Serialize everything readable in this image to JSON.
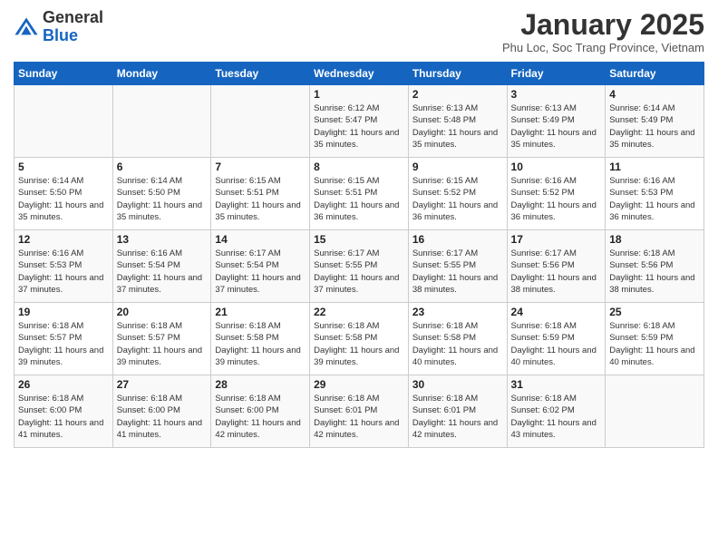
{
  "header": {
    "logo_general": "General",
    "logo_blue": "Blue",
    "month_title": "January 2025",
    "subtitle": "Phu Loc, Soc Trang Province, Vietnam"
  },
  "days_of_week": [
    "Sunday",
    "Monday",
    "Tuesday",
    "Wednesday",
    "Thursday",
    "Friday",
    "Saturday"
  ],
  "weeks": [
    [
      {
        "day": "",
        "info": ""
      },
      {
        "day": "",
        "info": ""
      },
      {
        "day": "",
        "info": ""
      },
      {
        "day": "1",
        "info": "Sunrise: 6:12 AM\nSunset: 5:47 PM\nDaylight: 11 hours and 35 minutes."
      },
      {
        "day": "2",
        "info": "Sunrise: 6:13 AM\nSunset: 5:48 PM\nDaylight: 11 hours and 35 minutes."
      },
      {
        "day": "3",
        "info": "Sunrise: 6:13 AM\nSunset: 5:49 PM\nDaylight: 11 hours and 35 minutes."
      },
      {
        "day": "4",
        "info": "Sunrise: 6:14 AM\nSunset: 5:49 PM\nDaylight: 11 hours and 35 minutes."
      }
    ],
    [
      {
        "day": "5",
        "info": "Sunrise: 6:14 AM\nSunset: 5:50 PM\nDaylight: 11 hours and 35 minutes."
      },
      {
        "day": "6",
        "info": "Sunrise: 6:14 AM\nSunset: 5:50 PM\nDaylight: 11 hours and 35 minutes."
      },
      {
        "day": "7",
        "info": "Sunrise: 6:15 AM\nSunset: 5:51 PM\nDaylight: 11 hours and 35 minutes."
      },
      {
        "day": "8",
        "info": "Sunrise: 6:15 AM\nSunset: 5:51 PM\nDaylight: 11 hours and 36 minutes."
      },
      {
        "day": "9",
        "info": "Sunrise: 6:15 AM\nSunset: 5:52 PM\nDaylight: 11 hours and 36 minutes."
      },
      {
        "day": "10",
        "info": "Sunrise: 6:16 AM\nSunset: 5:52 PM\nDaylight: 11 hours and 36 minutes."
      },
      {
        "day": "11",
        "info": "Sunrise: 6:16 AM\nSunset: 5:53 PM\nDaylight: 11 hours and 36 minutes."
      }
    ],
    [
      {
        "day": "12",
        "info": "Sunrise: 6:16 AM\nSunset: 5:53 PM\nDaylight: 11 hours and 37 minutes."
      },
      {
        "day": "13",
        "info": "Sunrise: 6:16 AM\nSunset: 5:54 PM\nDaylight: 11 hours and 37 minutes."
      },
      {
        "day": "14",
        "info": "Sunrise: 6:17 AM\nSunset: 5:54 PM\nDaylight: 11 hours and 37 minutes."
      },
      {
        "day": "15",
        "info": "Sunrise: 6:17 AM\nSunset: 5:55 PM\nDaylight: 11 hours and 37 minutes."
      },
      {
        "day": "16",
        "info": "Sunrise: 6:17 AM\nSunset: 5:55 PM\nDaylight: 11 hours and 38 minutes."
      },
      {
        "day": "17",
        "info": "Sunrise: 6:17 AM\nSunset: 5:56 PM\nDaylight: 11 hours and 38 minutes."
      },
      {
        "day": "18",
        "info": "Sunrise: 6:18 AM\nSunset: 5:56 PM\nDaylight: 11 hours and 38 minutes."
      }
    ],
    [
      {
        "day": "19",
        "info": "Sunrise: 6:18 AM\nSunset: 5:57 PM\nDaylight: 11 hours and 39 minutes."
      },
      {
        "day": "20",
        "info": "Sunrise: 6:18 AM\nSunset: 5:57 PM\nDaylight: 11 hours and 39 minutes."
      },
      {
        "day": "21",
        "info": "Sunrise: 6:18 AM\nSunset: 5:58 PM\nDaylight: 11 hours and 39 minutes."
      },
      {
        "day": "22",
        "info": "Sunrise: 6:18 AM\nSunset: 5:58 PM\nDaylight: 11 hours and 39 minutes."
      },
      {
        "day": "23",
        "info": "Sunrise: 6:18 AM\nSunset: 5:58 PM\nDaylight: 11 hours and 40 minutes."
      },
      {
        "day": "24",
        "info": "Sunrise: 6:18 AM\nSunset: 5:59 PM\nDaylight: 11 hours and 40 minutes."
      },
      {
        "day": "25",
        "info": "Sunrise: 6:18 AM\nSunset: 5:59 PM\nDaylight: 11 hours and 40 minutes."
      }
    ],
    [
      {
        "day": "26",
        "info": "Sunrise: 6:18 AM\nSunset: 6:00 PM\nDaylight: 11 hours and 41 minutes."
      },
      {
        "day": "27",
        "info": "Sunrise: 6:18 AM\nSunset: 6:00 PM\nDaylight: 11 hours and 41 minutes."
      },
      {
        "day": "28",
        "info": "Sunrise: 6:18 AM\nSunset: 6:00 PM\nDaylight: 11 hours and 42 minutes."
      },
      {
        "day": "29",
        "info": "Sunrise: 6:18 AM\nSunset: 6:01 PM\nDaylight: 11 hours and 42 minutes."
      },
      {
        "day": "30",
        "info": "Sunrise: 6:18 AM\nSunset: 6:01 PM\nDaylight: 11 hours and 42 minutes."
      },
      {
        "day": "31",
        "info": "Sunrise: 6:18 AM\nSunset: 6:02 PM\nDaylight: 11 hours and 43 minutes."
      },
      {
        "day": "",
        "info": ""
      }
    ]
  ]
}
